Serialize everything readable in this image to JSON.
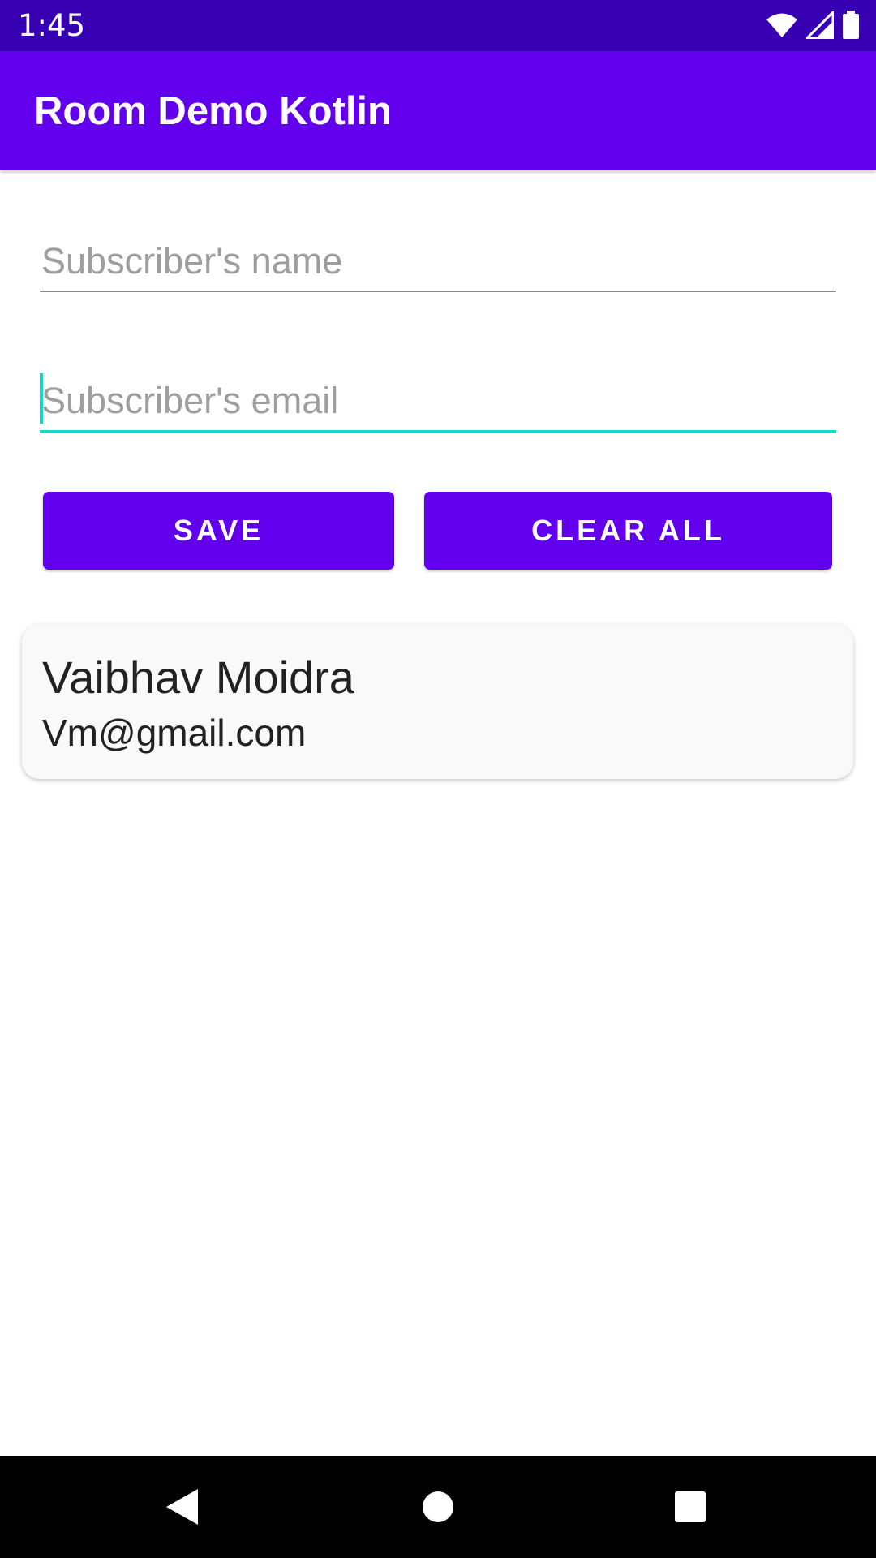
{
  "status_bar": {
    "time": "1:45",
    "icons": [
      "wifi-icon",
      "cellular-signal-icon",
      "battery-icon"
    ]
  },
  "app_bar": {
    "title": "Room Demo Kotlin"
  },
  "form": {
    "name_field": {
      "value": "",
      "placeholder": "Subscriber's name"
    },
    "email_field": {
      "value": "",
      "placeholder": "Subscriber's email"
    }
  },
  "buttons": {
    "save_label": "SAVE",
    "clear_all_label": "CLEAR ALL"
  },
  "subscribers": [
    {
      "name": "Vaibhav Moidra",
      "email": "Vm@gmail.com"
    }
  ],
  "nav_bar": {
    "icons": [
      "back-icon",
      "home-icon",
      "recents-icon"
    ]
  },
  "colors": {
    "status_bar": "#3700b3",
    "primary": "#6200ee",
    "accent": "#18d6c6",
    "card_background": "#f9f9f9"
  }
}
